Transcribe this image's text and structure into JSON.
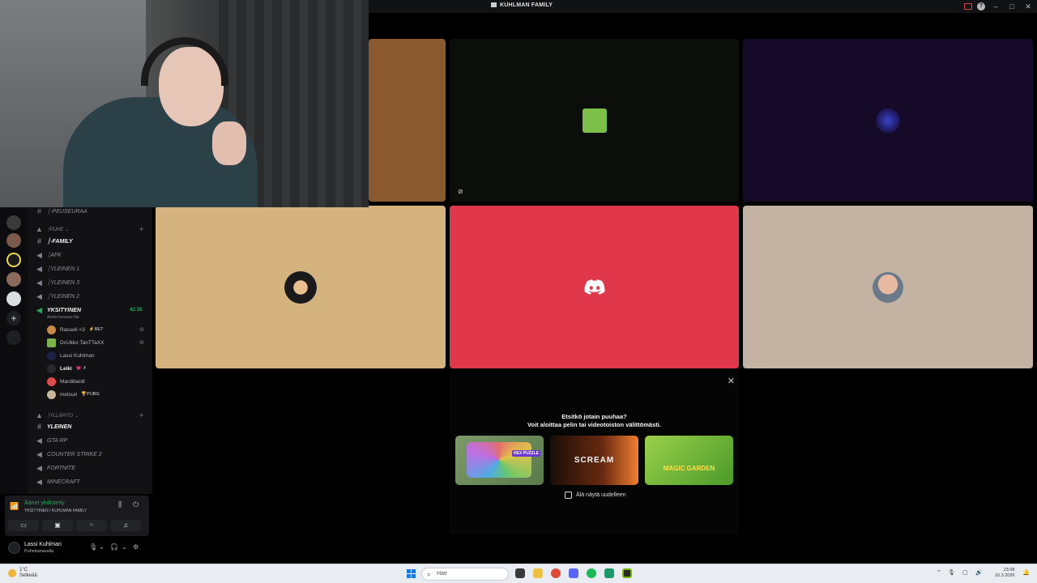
{
  "window": {
    "title": "KUHLMAN FAMILY"
  },
  "channels": [
    {
      "kind": "text",
      "label": "┆-PEUSEURAA"
    },
    {
      "kind": "category",
      "label": "┆PUHE ⌄"
    },
    {
      "kind": "text",
      "label": "┆-FAMILY"
    },
    {
      "kind": "voice",
      "label": "┆AFK"
    },
    {
      "kind": "voice",
      "label": "┆YLEINEN 1"
    },
    {
      "kind": "voice",
      "label": "┆YLEINEN 3"
    },
    {
      "kind": "voice",
      "label": "┆YLEINEN 2"
    },
    {
      "kind": "voice-active",
      "label": "YKSITYINEN",
      "timer": "42:35",
      "sub": "Aseta keraavs tila"
    },
    {
      "kind": "category",
      "label": "┆YLLÄPITO ⌄"
    },
    {
      "kind": "text",
      "label": "YLEINEN"
    },
    {
      "kind": "voice",
      "label": "GTA RP"
    },
    {
      "kind": "voice",
      "label": "COUNTER STRIKE 2"
    },
    {
      "kind": "voice",
      "label": "FORTNITE"
    },
    {
      "kind": "voice",
      "label": "MINECRAFT"
    }
  ],
  "members": [
    {
      "name": "Rasueli <3",
      "tag": "⚡BET",
      "color": "#c88a4a"
    },
    {
      "name": "DcUkko TanTTaXX",
      "tag": "",
      "color": "#7bb34a"
    },
    {
      "name": "Lassi Kuhlman",
      "tag": "",
      "color": "#1e1f4a"
    },
    {
      "name": "Leiki",
      "tag": "💗 ✗",
      "color": "#2a2a2a"
    },
    {
      "name": "Mardibardi",
      "tag": "",
      "color": "#e04a4a"
    },
    {
      "name": "metsuri",
      "tag": "🏆PUBG",
      "color": "#c9b89a"
    }
  ],
  "voice_status": {
    "connected": "Äänet yhdistetty",
    "location": "YKSITYINEN / KUHLMAN FAMILY"
  },
  "user": {
    "name": "Lassi Kuhlman",
    "status": "Puhekanavalla"
  },
  "tile_colors": {
    "tile1": "#8a5a2e",
    "tile2": "#0c0e0c",
    "tile3": "#150a28",
    "tile4": "#d4b37f",
    "tile5": "#e0384a",
    "tile6": "#c4b3a3"
  },
  "activity": {
    "heading": "Etsitkö jotain puuhaa?",
    "subheading": "Voit aloittaa pelin tai videotoiston välittömästi.",
    "games": [
      {
        "name": "HEX PUZZLE"
      },
      {
        "name": "SCREAM"
      },
      {
        "name": "MAGIC GARDEN"
      }
    ],
    "dont_show": "Älä näytä uudelleen"
  },
  "taskbar": {
    "weather_temp": "1°C",
    "weather_desc": "Selkeää",
    "search_placeholder": "Hae",
    "time": "23.08",
    "date": "10.3.2026"
  }
}
